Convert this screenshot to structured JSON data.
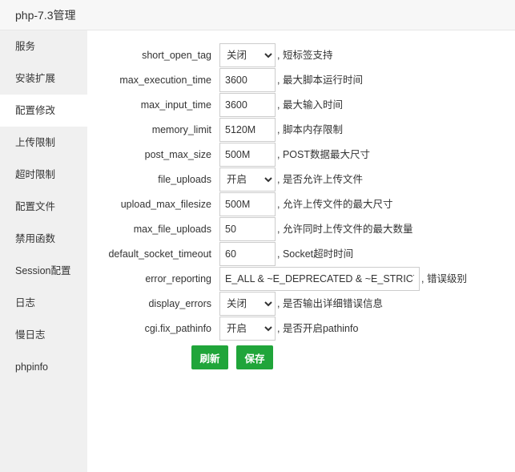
{
  "window": {
    "title": "php-7.3管理"
  },
  "sidebar": {
    "items": [
      {
        "label": "服务"
      },
      {
        "label": "安装扩展"
      },
      {
        "label": "配置修改"
      },
      {
        "label": "上传限制"
      },
      {
        "label": "超时限制"
      },
      {
        "label": "配置文件"
      },
      {
        "label": "禁用函数"
      },
      {
        "label": "Session配置"
      },
      {
        "label": "日志"
      },
      {
        "label": "慢日志"
      },
      {
        "label": "phpinfo"
      }
    ],
    "active": "配置修改"
  },
  "settings": [
    {
      "label": "short_open_tag",
      "type": "select",
      "value": "关闭",
      "hint": ", 短标签支持"
    },
    {
      "label": "max_execution_time",
      "type": "input",
      "value": "3600",
      "hint": ", 最大脚本运行时间"
    },
    {
      "label": "max_input_time",
      "type": "input",
      "value": "3600",
      "hint": ", 最大输入时间"
    },
    {
      "label": "memory_limit",
      "type": "input",
      "value": "5120M",
      "hint": ", 脚本内存限制"
    },
    {
      "label": "post_max_size",
      "type": "input",
      "value": "500M",
      "hint": ", POST数据最大尺寸"
    },
    {
      "label": "file_uploads",
      "type": "select",
      "value": "开启",
      "hint": ", 是否允许上传文件"
    },
    {
      "label": "upload_max_filesize",
      "type": "input",
      "value": "500M",
      "hint": ", 允许上传文件的最大尺寸"
    },
    {
      "label": "max_file_uploads",
      "type": "input",
      "value": "50",
      "hint": ", 允许同时上传文件的最大数量"
    },
    {
      "label": "default_socket_timeout",
      "type": "input",
      "value": "60",
      "hint": ", Socket超时时间"
    },
    {
      "label": "error_reporting",
      "type": "input",
      "value": "E_ALL & ~E_DEPRECATED & ~E_STRICT",
      "hint": ", 错误级别"
    },
    {
      "label": "display_errors",
      "type": "select",
      "value": "关闭",
      "hint": ", 是否输出详细错误信息"
    },
    {
      "label": "cgi.fix_pathinfo",
      "type": "select",
      "value": "开启",
      "hint": ", 是否开启pathinfo"
    }
  ],
  "buttons": {
    "refresh_label": "刷新",
    "save_label": "保存"
  },
  "colors": {
    "accent": "#20a53a",
    "sidebar_bg": "#f0f0f0"
  }
}
